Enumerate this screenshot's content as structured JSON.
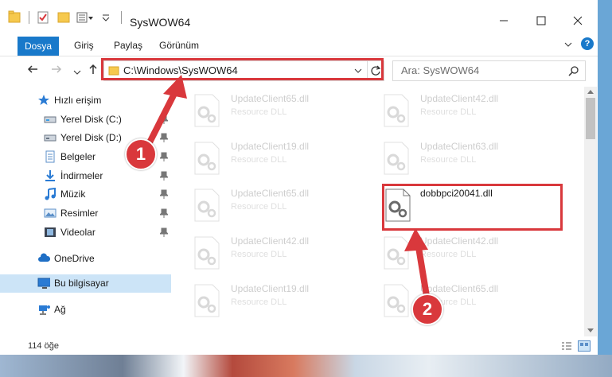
{
  "window": {
    "title": "SysWOW64",
    "controls": [
      "minimize-icon",
      "maximize-icon",
      "close-icon"
    ]
  },
  "ribbon": {
    "tabs": [
      "Dosya",
      "Giriş",
      "Paylaş",
      "Görünüm"
    ]
  },
  "navigation": {
    "address": "C:\\Windows\\SysWOW64",
    "search_placeholder": "Ara: SysWOW64"
  },
  "sidebar": {
    "items": [
      {
        "label": "Hızlı erişim",
        "icon": "star-icon"
      },
      {
        "label": "Yerel Disk (C:)",
        "icon": "drive-icon"
      },
      {
        "label": "Yerel Disk (D:)",
        "icon": "drive-icon"
      },
      {
        "label": "Belgeler",
        "icon": "document-icon"
      },
      {
        "label": "İndirmeler",
        "icon": "download-icon"
      },
      {
        "label": "Müzik",
        "icon": "music-icon"
      },
      {
        "label": "Resimler",
        "icon": "picture-icon"
      },
      {
        "label": "Videolar",
        "icon": "video-icon"
      },
      {
        "label": "OneDrive",
        "icon": "cloud-icon"
      },
      {
        "label": "Bu bilgisayar",
        "icon": "computer-icon"
      },
      {
        "label": "Ağ",
        "icon": "network-icon"
      }
    ]
  },
  "files": {
    "items": [
      {
        "name": "UpdateClient65.dll",
        "type": "Resource DLL"
      },
      {
        "name": "UpdateClient42.dll",
        "type": "Resource DLL"
      },
      {
        "name": "UpdateClient19.dll",
        "type": "Resource DLL"
      },
      {
        "name": "UpdateClient63.dll",
        "type": "Resource DLL"
      },
      {
        "name": "UpdateClient65.dll",
        "type": "Resource DLL"
      },
      {
        "name": "dobbpci20041.dll",
        "type": ""
      },
      {
        "name": "UpdateClient42.dll",
        "type": "Resource DLL"
      },
      {
        "name": "UpdateClient42.dll",
        "type": "Resource DLL"
      },
      {
        "name": "UpdateClient19.dll",
        "type": "Resource DLL"
      },
      {
        "name": "UpdateClient65.dll",
        "type": "Resource DLL"
      }
    ]
  },
  "status": {
    "count": "114 öğe"
  },
  "callouts": {
    "step1": "1",
    "step2": "2"
  },
  "colors": {
    "accent": "#1979ca",
    "highlight": "#d9383c",
    "selected": "#cce4f7"
  }
}
